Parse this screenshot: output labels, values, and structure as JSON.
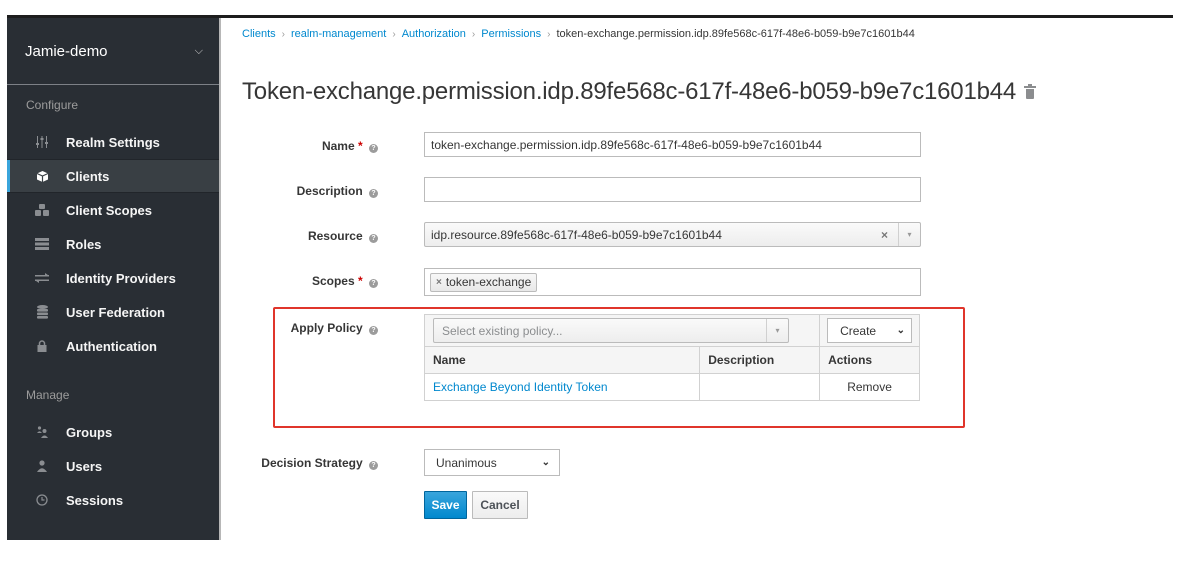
{
  "sidebar": {
    "realm_name": "Jamie-demo",
    "realm_chevron": "⌄",
    "configure_title": "Configure",
    "manage_title": "Manage",
    "configure_items": [
      {
        "label": "Realm Settings",
        "icon": "sliders-icon",
        "glyph": "⫶"
      },
      {
        "label": "Clients",
        "icon": "cube-icon",
        "glyph": "⬢",
        "active": true
      },
      {
        "label": "Client Scopes",
        "icon": "cubes-icon",
        "glyph": "⁂"
      },
      {
        "label": "Roles",
        "icon": "list-icon",
        "glyph": "☰"
      },
      {
        "label": "Identity Providers",
        "icon": "exchange-icon",
        "glyph": "⇄"
      },
      {
        "label": "User Federation",
        "icon": "database-icon",
        "glyph": "≣"
      },
      {
        "label": "Authentication",
        "icon": "lock-icon",
        "glyph": "🔒"
      }
    ],
    "manage_items": [
      {
        "label": "Groups",
        "icon": "users-icon",
        "glyph": "👥"
      },
      {
        "label": "Users",
        "icon": "user-icon",
        "glyph": "👤"
      },
      {
        "label": "Sessions",
        "icon": "clock-icon",
        "glyph": "◷"
      }
    ]
  },
  "breadcrumb": {
    "items": [
      "Clients",
      "realm-management",
      "Authorization",
      "Permissions"
    ],
    "current": "token-exchange.permission.idp.89fe568c-617f-48e6-b059-b9e7c1601b44",
    "separator": "›"
  },
  "page": {
    "title": "Token-exchange.permission.idp.89fe568c-617f-48e6-b059-b9e7c1601b44"
  },
  "form": {
    "name": {
      "label": "Name",
      "required": "*",
      "value": "token-exchange.permission.idp.89fe568c-617f-48e6-b059-b9e7c1601b44"
    },
    "description": {
      "label": "Description",
      "value": ""
    },
    "resource": {
      "label": "Resource",
      "value": "idp.resource.89fe568c-617f-48e6-b059-b9e7c1601b44",
      "clear": "×",
      "arrow": "▾"
    },
    "scopes": {
      "label": "Scopes",
      "required": "*",
      "tags": [
        "token-exchange"
      ],
      "tag_remove": "×"
    },
    "apply_policy": {
      "label": "Apply Policy",
      "select_placeholder": "Select existing policy...",
      "select_arrow": "▾",
      "create_label": "Create",
      "create_chevron": "⌄",
      "columns": [
        "Name",
        "Description",
        "Actions"
      ],
      "rows": [
        {
          "name": "Exchange Beyond Identity Token",
          "description": "",
          "action": "Remove"
        }
      ]
    },
    "decision_strategy": {
      "label": "Decision Strategy",
      "value": "Unanimous",
      "chevron": "⌄"
    },
    "help_glyph": "?"
  },
  "buttons": {
    "save": "Save",
    "cancel": "Cancel"
  }
}
